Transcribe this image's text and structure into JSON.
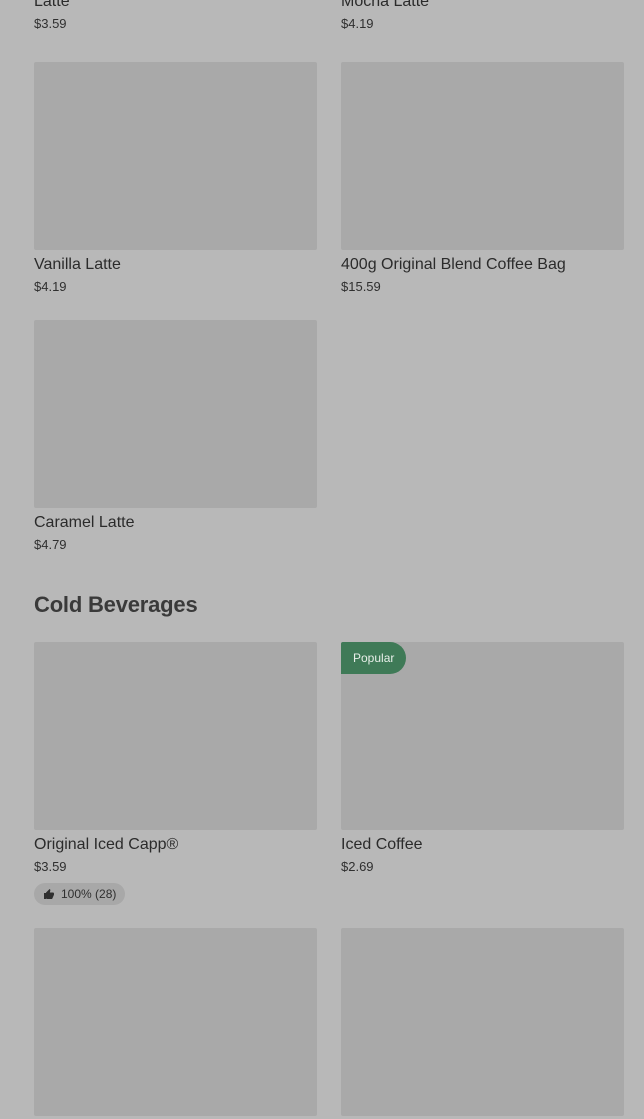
{
  "top_items": [
    {
      "name": "Latte",
      "price": "$3.59"
    },
    {
      "name": "Mocha Latte",
      "price": "$4.19"
    }
  ],
  "hot_items": [
    {
      "name": "Vanilla Latte",
      "price": "$4.19"
    },
    {
      "name": "400g Original Blend Coffee Bag",
      "price": "$15.59"
    },
    {
      "name": "Caramel Latte",
      "price": "$4.79"
    }
  ],
  "cold_section": {
    "title": "Cold Beverages",
    "items": [
      {
        "name": "Original Iced Capp®",
        "price": "$3.59",
        "rating": "100% (28)"
      },
      {
        "name": "Iced Coffee",
        "price": "$2.69",
        "badge": "Popular"
      }
    ]
  },
  "icons": {
    "rating": "thumbs-up-icon"
  }
}
